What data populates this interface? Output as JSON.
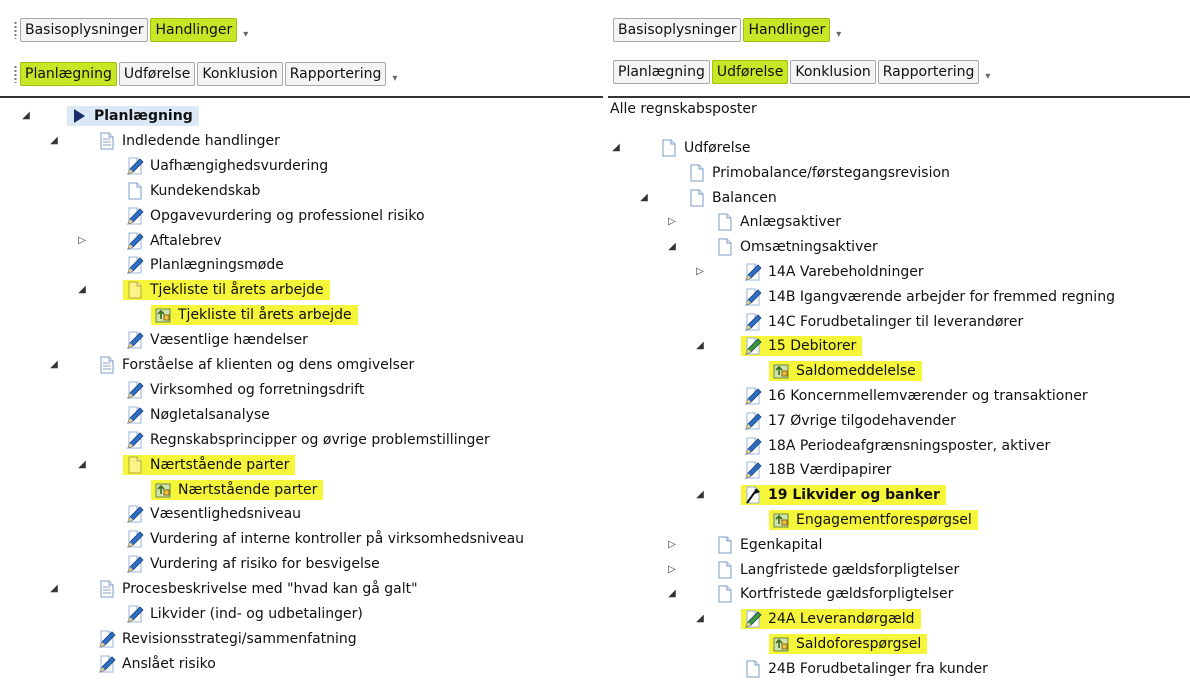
{
  "left": {
    "top_tabs": [
      {
        "label": "Basisoplysninger",
        "active": false
      },
      {
        "label": "Handlinger",
        "active": true
      }
    ],
    "sub_tabs": [
      {
        "label": "Planlægning",
        "active": true
      },
      {
        "label": "Udførelse",
        "active": false
      },
      {
        "label": "Konklusion",
        "active": false
      },
      {
        "label": "Rapportering",
        "active": false
      }
    ],
    "tree": [
      {
        "label": "Planlægning",
        "level": 0,
        "icon": "play-arrow-icon",
        "expander": "expanded",
        "bold": true,
        "selected": true
      },
      {
        "label": "Indledende handlinger",
        "level": 1,
        "icon": "folder-document-icon",
        "expander": "expanded"
      },
      {
        "label": "Uafhængighedsvurdering",
        "level": 2,
        "icon": "pencil-document-icon"
      },
      {
        "label": "Kundekendskab",
        "level": 2,
        "icon": "document-icon"
      },
      {
        "label": "Opgavevurdering og professionel risiko",
        "level": 2,
        "icon": "pencil-document-icon"
      },
      {
        "label": "Aftalebrev",
        "level": 2,
        "icon": "pencil-document-icon",
        "expander": "collapsed"
      },
      {
        "label": "Planlægningsmøde",
        "level": 2,
        "icon": "pencil-document-icon"
      },
      {
        "label": "Tjekliste til årets arbejde",
        "level": 2,
        "icon": "yellow-document-icon",
        "expander": "expanded",
        "highlight": true
      },
      {
        "label": "Tjekliste til årets arbejde",
        "level": 3,
        "icon": "checklist-icon",
        "highlight": true
      },
      {
        "label": "Væsentlige hændelser",
        "level": 2,
        "icon": "pencil-document-icon"
      },
      {
        "label": "Forståelse af klienten og dens omgivelser",
        "level": 1,
        "icon": "folder-document-icon",
        "expander": "expanded"
      },
      {
        "label": "Virksomhed og forretningsdrift",
        "level": 2,
        "icon": "pencil-document-icon"
      },
      {
        "label": "Nøgletalsanalyse",
        "level": 2,
        "icon": "pencil-document-icon"
      },
      {
        "label": "Regnskabsprincipper og øvrige problemstillinger",
        "level": 2,
        "icon": "pencil-document-icon"
      },
      {
        "label": "Nærtstående parter",
        "level": 2,
        "icon": "yellow-document-icon",
        "expander": "expanded",
        "highlight": true
      },
      {
        "label": "Nærtstående parter",
        "level": 3,
        "icon": "checklist-icon",
        "highlight": true
      },
      {
        "label": "Væsentlighedsniveau",
        "level": 2,
        "icon": "pencil-document-icon"
      },
      {
        "label": "Vurdering af interne kontroller på virksomhedsniveau",
        "level": 2,
        "icon": "pencil-document-icon"
      },
      {
        "label": "Vurdering af risiko for besvigelse",
        "level": 2,
        "icon": "pencil-document-icon"
      },
      {
        "label": "Procesbeskrivelse med \"hvad kan gå galt\"",
        "level": 1,
        "icon": "folder-document-icon",
        "expander": "expanded"
      },
      {
        "label": "Likvider (ind- og udbetalinger)",
        "level": 2,
        "icon": "pencil-document-icon"
      },
      {
        "label": "Revisionsstrategi/sammenfatning",
        "level": 1,
        "icon": "pencil-document-icon"
      },
      {
        "label": "Anslået risiko",
        "level": 1,
        "icon": "pencil-document-icon"
      }
    ]
  },
  "right": {
    "top_tabs": [
      {
        "label": "Basisoplysninger",
        "active": false
      },
      {
        "label": "Handlinger",
        "active": true
      }
    ],
    "sub_tabs": [
      {
        "label": "Planlægning",
        "active": false
      },
      {
        "label": "Udførelse",
        "active": true
      },
      {
        "label": "Konklusion",
        "active": false
      },
      {
        "label": "Rapportering",
        "active": false
      }
    ],
    "filter_label": "Alle regnskabsposter",
    "tree": [
      {
        "label": "Udførelse",
        "level": 0,
        "icon": "document-icon",
        "expander": "expanded"
      },
      {
        "label": "Primobalance/førstegangsrevision",
        "level": 1,
        "icon": "document-icon"
      },
      {
        "label": "Balancen",
        "level": 1,
        "icon": "document-icon",
        "expander": "expanded"
      },
      {
        "label": "Anlægsaktiver",
        "level": 2,
        "icon": "document-icon",
        "expander": "collapsed"
      },
      {
        "label": "Omsætningsaktiver",
        "level": 2,
        "icon": "document-icon",
        "expander": "expanded"
      },
      {
        "label": "14A Varebeholdninger",
        "level": 3,
        "icon": "pencil-document-icon",
        "expander": "collapsed"
      },
      {
        "label": "14B Igangværende arbejder for fremmed regning",
        "level": 3,
        "icon": "pencil-document-icon"
      },
      {
        "label": "14C Forudbetalinger til leverandører",
        "level": 3,
        "icon": "pencil-document-icon"
      },
      {
        "label": "15 Debitorer",
        "level": 3,
        "icon": "green-pencil-document-icon",
        "expander": "expanded",
        "highlight": true
      },
      {
        "label": "Saldomeddelelse",
        "level": 4,
        "icon": "checklist-icon",
        "highlight": true
      },
      {
        "label": "16 Koncernmellemværender og transaktioner",
        "level": 3,
        "icon": "pencil-document-icon"
      },
      {
        "label": "17 Øvrige tilgodehavender",
        "level": 3,
        "icon": "pencil-document-icon"
      },
      {
        "label": "18A Periodeafgrænsningsposter, aktiver",
        "level": 3,
        "icon": "pencil-document-icon"
      },
      {
        "label": "18B Værdipapirer",
        "level": 3,
        "icon": "pencil-document-icon"
      },
      {
        "label": "19 Likvider og banker",
        "level": 3,
        "icon": "flag-document-icon",
        "expander": "expanded",
        "highlight": true,
        "bold": true
      },
      {
        "label": "Engagementforespørgsel",
        "level": 4,
        "icon": "checklist-icon",
        "highlight": true
      },
      {
        "label": "Egenkapital",
        "level": 2,
        "icon": "document-icon",
        "expander": "collapsed"
      },
      {
        "label": "Langfristede gældsforpligtelser",
        "level": 2,
        "icon": "document-icon",
        "expander": "collapsed"
      },
      {
        "label": "Kortfristede gældsforpligtelser",
        "level": 2,
        "icon": "document-icon",
        "expander": "expanded"
      },
      {
        "label": "24A Leverandørgæld",
        "level": 3,
        "icon": "green-pencil-document-icon",
        "expander": "expanded",
        "highlight": true
      },
      {
        "label": "Saldoforespørgsel",
        "level": 4,
        "icon": "checklist-icon",
        "highlight": true
      },
      {
        "label": "24B Forudbetalinger fra kunder",
        "level": 3,
        "icon": "document-icon"
      }
    ]
  },
  "glyphs": {
    "expanded": "◢",
    "collapsed": "▷",
    "overflow": "▾"
  },
  "colors": {
    "active_tab": "#c6e626",
    "highlight": "#f5f53a",
    "selected": "#dbe8f5",
    "icon_blue": "#2d6fc4"
  }
}
